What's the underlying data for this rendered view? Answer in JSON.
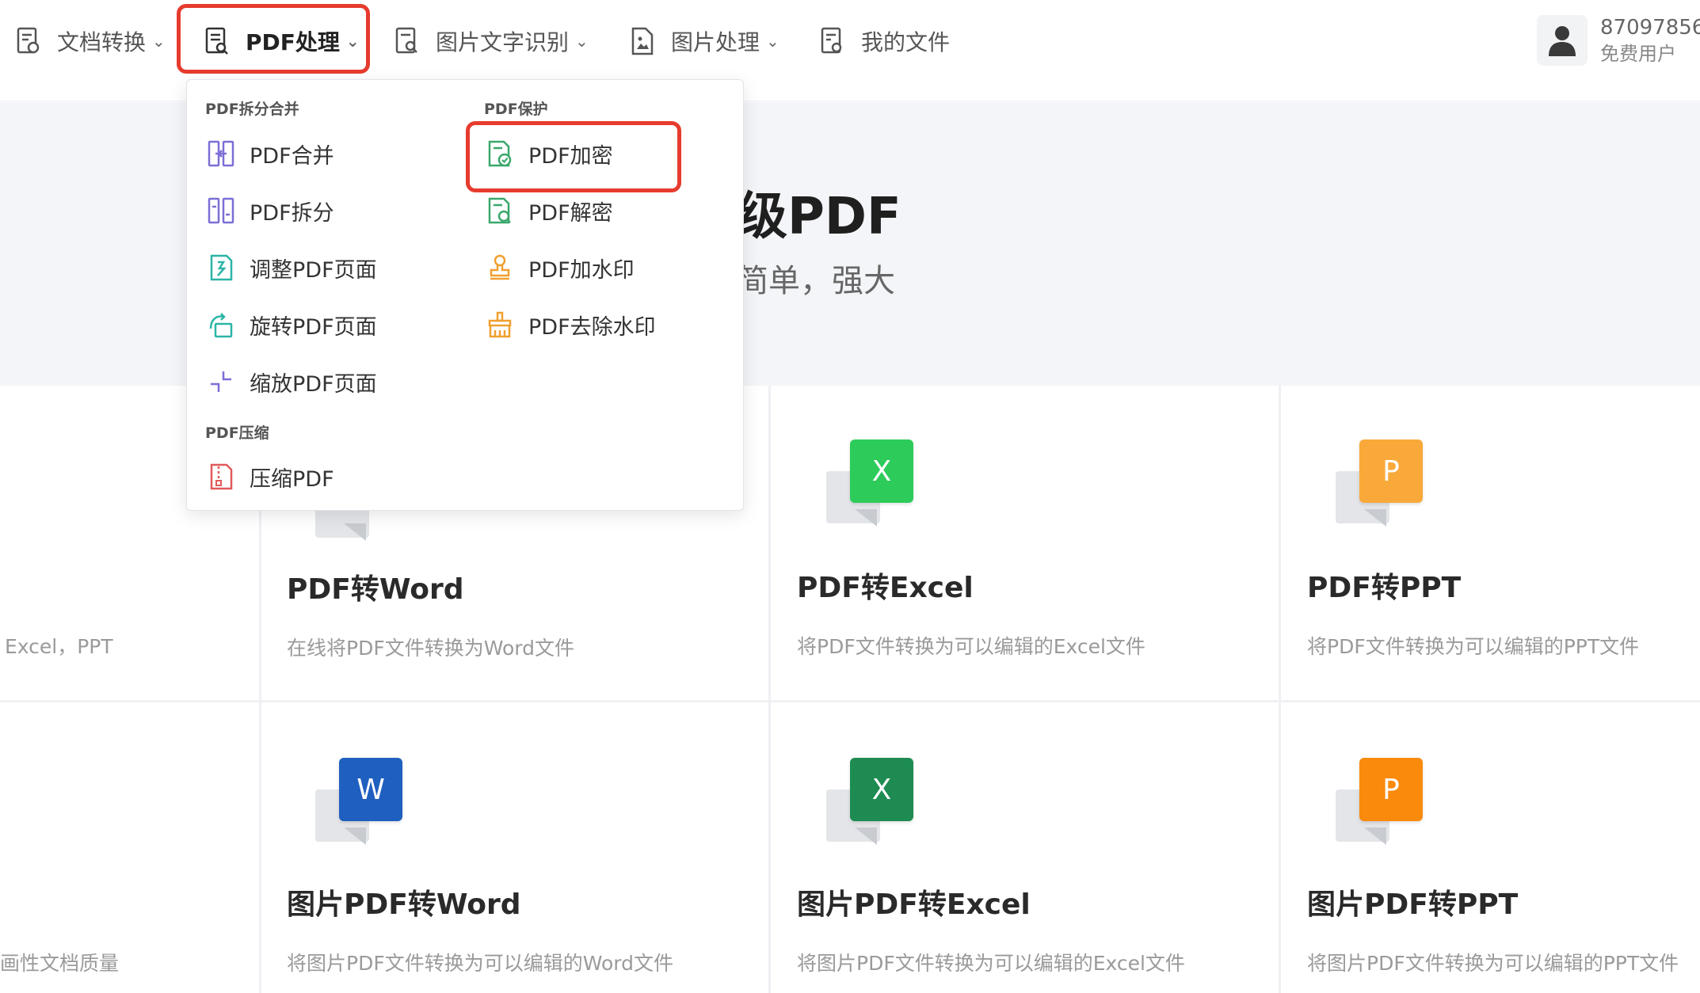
{
  "nav": {
    "items": [
      {
        "label": "文档转换",
        "icon": "doc-convert-icon"
      },
      {
        "label": "PDF处理",
        "icon": "pdf-process-icon"
      },
      {
        "label": "图片文字识别",
        "icon": "ocr-icon"
      },
      {
        "label": "图片处理",
        "icon": "image-process-icon"
      },
      {
        "label": "我的文件",
        "icon": "my-files-icon"
      }
    ],
    "active": "PDF处理"
  },
  "user": {
    "id": "87097856",
    "role": "免费用户"
  },
  "hero": {
    "title": "级PDF",
    "subtitle": "简单，强大"
  },
  "dropdown": {
    "groups": {
      "split_merge": "PDF拆分合并",
      "protect": "PDF保护",
      "compress": "PDF压缩"
    },
    "items": {
      "merge": "PDF合并",
      "split": "PDF拆分",
      "adjust": "调整PDF页面",
      "rotate": "旋转PDF页面",
      "scale": "缩放PDF页面",
      "compress": "压缩PDF",
      "encrypt": "PDF加密",
      "decrypt": "PDF解密",
      "watermark_add": "PDF加水印",
      "watermark_remove": "PDF去除水印"
    },
    "colors": {
      "purple": "#7b6fd6",
      "teal": "#2bb5a6",
      "green": "#3aa86b",
      "orange": "#f0a030",
      "red": "#e25a5a"
    }
  },
  "cards": {
    "row1": [
      {
        "title": "",
        "desc": "Excel，PPT"
      },
      {
        "title": "PDF转Word",
        "desc": "在线将PDF文件转换为Word文件"
      },
      {
        "title": "PDF转Excel",
        "desc": "将PDF文件转换为可以编辑的Excel文件",
        "icon_letter": "X",
        "icon_color": "#2dcc5a"
      },
      {
        "title": "PDF转PPT",
        "desc": "将PDF文件转换为可以编辑的PPT文件",
        "icon_letter": "P",
        "icon_color": "#f9a93a"
      }
    ],
    "row2": [
      {
        "title": "",
        "desc": "画性文档质量"
      },
      {
        "title": "图片PDF转Word",
        "desc": "将图片PDF文件转换为可以编辑的Word文件",
        "icon_letter": "W",
        "icon_color": "#1f5fbf"
      },
      {
        "title": "图片PDF转Excel",
        "desc": "将图片PDF文件转换为可以编辑的Excel文件",
        "icon_letter": "X",
        "icon_color": "#1e8c52"
      },
      {
        "title": "图片PDF转PPT",
        "desc": "将图片PDF文件转换为可以编辑的PPT文件",
        "icon_letter": "P",
        "icon_color": "#f98a0c"
      }
    ]
  }
}
